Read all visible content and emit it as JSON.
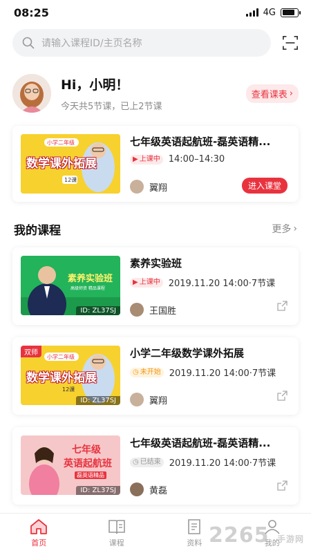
{
  "status_bar": {
    "time": "08:25",
    "network": "4G"
  },
  "search": {
    "placeholder": "请输入课程ID/主页名称"
  },
  "greeting": {
    "title": "Hi，小明！",
    "subtitle": "今天共5节课，已上2节课",
    "schedule_button": "查看课表"
  },
  "live_course": {
    "title": "七年级英语起航班-磊英语精...",
    "status": "上课中",
    "time": "14:00–14:30",
    "teacher": "翼翔",
    "enter_button": "进入课堂",
    "thumb": {
      "line1": "小学二年级",
      "line2": "数学课外拓展",
      "line3": "12课"
    }
  },
  "my_courses": {
    "title": "我的课程",
    "more": "更多",
    "items": [
      {
        "title": "素养实验班",
        "status": "上课中",
        "status_type": "live",
        "date": "2019.11.20 14:00·7节课",
        "teacher": "王国胜",
        "id": "ID: ZL37SJ",
        "thumb": {
          "line1": "素养实验班",
          "line2": "高级师资 精品课程"
        }
      },
      {
        "title": "小学二年级数学课外拓展",
        "status": "未开始",
        "status_type": "upcoming",
        "date": "2019.11.20 14:00·7节课",
        "teacher": "翼翔",
        "id": "ID: ZL37SJ",
        "badge": "双师",
        "thumb": {
          "line1": "小学二年级",
          "line2": "数学课外拓展",
          "line3": "12课"
        }
      },
      {
        "title": "七年级英语起航班-磊英语精...",
        "status": "已结束",
        "status_type": "ended",
        "date": "2019.11.20 14:00·7节课",
        "teacher": "黄磊",
        "id": "ID: ZL37SJ",
        "thumb": {
          "line1": "七年级",
          "line2": "英语起航班",
          "line3": "磊英语精品"
        }
      }
    ]
  },
  "tabs": [
    {
      "label": "首页",
      "icon": "home-icon",
      "active": true
    },
    {
      "label": "课程",
      "icon": "book-icon",
      "active": false
    },
    {
      "label": "资料",
      "icon": "document-icon",
      "active": false
    },
    {
      "label": "我的",
      "icon": "user-icon",
      "active": false
    }
  ],
  "watermark": {
    "brand": "2265",
    "sub": "手游网"
  },
  "colors": {
    "accent": "#e8333f",
    "upcoming": "#f09a1a",
    "ended": "#9a9a9a",
    "thumb_yellow": "#f7d12e",
    "thumb_green": "#23b35a",
    "thumb_pink": "#f6c7c9"
  }
}
